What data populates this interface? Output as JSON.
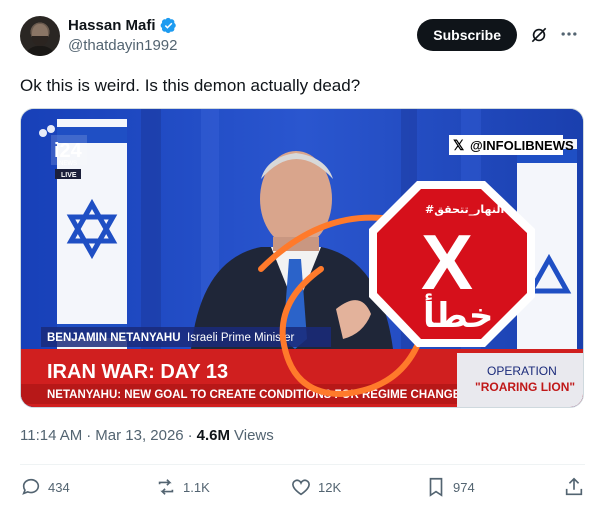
{
  "author": {
    "name": "Hassan Mafi",
    "handle": "@thatdayin1992",
    "verified": true
  },
  "header_actions": {
    "subscribe_label": "Subscribe",
    "grok_icon": "grok-icon",
    "more_icon": "more-icon"
  },
  "tweet": {
    "text": "Ok this is weird. Is this demon actually dead?"
  },
  "media": {
    "channel_logo": "i24",
    "channel_sub": "NEWS",
    "live_label": "LIVE",
    "watermark": "@INFOLIBNEWS",
    "speaker_name": "BENJAMIN NETANYAHU",
    "speaker_title": "Israeli Prime Minister",
    "headline": "IRAN WAR: DAY 13",
    "ticker": "NETANYAHU: NEW GOAL TO CREATE CONDITIONS FOR REGIME CHANGE",
    "operation_label": "OPERATION",
    "operation_name": "\"ROARING LION\"",
    "stop_hashtag": "#النهار_تتحقق",
    "stop_word": "خطأ",
    "stop_mark": "X"
  },
  "meta": {
    "time": "11:14 AM",
    "separator": "·",
    "date": "Mar 13, 2026",
    "views_count": "4.6M",
    "views_label": "Views"
  },
  "actions": {
    "replies": "434",
    "reposts": "1.1K",
    "likes": "12K",
    "bookmarks": "974"
  },
  "colors": {
    "text_primary": "#0f1419",
    "text_secondary": "#536471",
    "verified_blue": "#1d9bf0",
    "broadcast_red": "#d01f1f",
    "stop_red": "#d6101b",
    "circle_orange": "#ff7a2b"
  }
}
